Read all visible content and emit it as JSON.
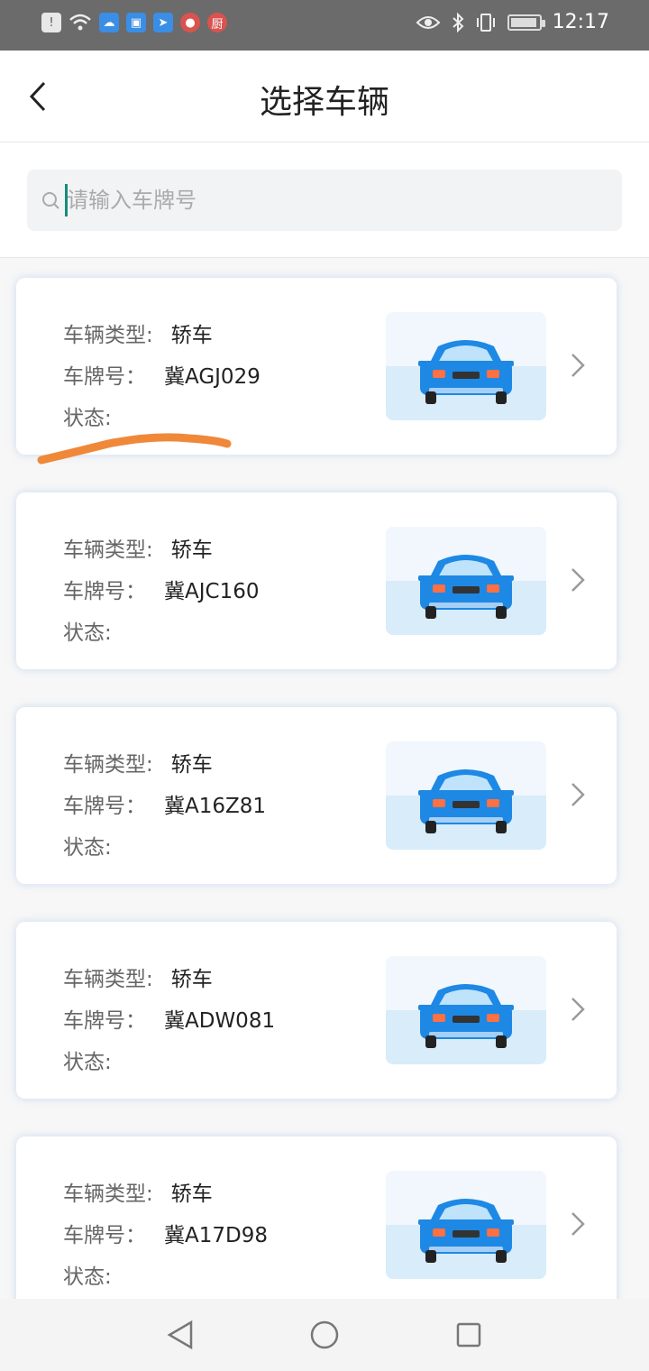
{
  "status_bar": {
    "time": "12:17"
  },
  "header": {
    "title": "选择车辆"
  },
  "search": {
    "placeholder": "请输入车牌号"
  },
  "labels": {
    "type": "车辆类型:",
    "plate": "车牌号：",
    "status": "状态:"
  },
  "vehicles": [
    {
      "type": "轿车",
      "plate": "冀AGJ029",
      "status": ""
    },
    {
      "type": "轿车",
      "plate": "冀AJC160",
      "status": ""
    },
    {
      "type": "轿车",
      "plate": "冀A16Z81",
      "status": ""
    },
    {
      "type": "轿车",
      "plate": "冀ADW081",
      "status": ""
    },
    {
      "type": "轿车",
      "plate": "冀A17D98",
      "status": ""
    }
  ],
  "colors": {
    "car_body": "#1e88e5",
    "accent": "#1a8a7a",
    "annotation": "#f0883a"
  },
  "icons": {
    "back": "chevron-left-icon",
    "search": "search-icon",
    "row_arrow": "chevron-right-icon",
    "nav_back": "triangle-back-icon",
    "nav_home": "circle-home-icon",
    "nav_recent": "square-recent-icon"
  }
}
